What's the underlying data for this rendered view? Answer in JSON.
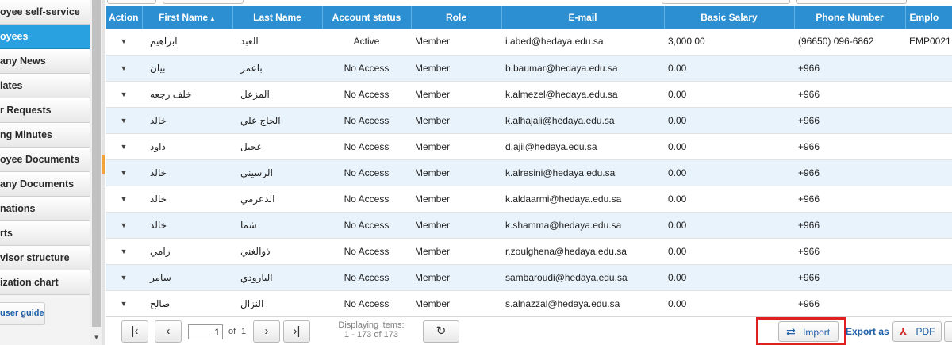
{
  "sidebar": {
    "items": [
      {
        "label": "oyee self-service"
      },
      {
        "label": "oyees"
      },
      {
        "label": "any News"
      },
      {
        "label": "lates"
      },
      {
        "label": "r Requests"
      },
      {
        "label": "ng Minutes"
      },
      {
        "label": "oyee Documents"
      },
      {
        "label": "any Documents"
      },
      {
        "label": "nations"
      },
      {
        "label": "rts"
      },
      {
        "label": "visor structure"
      },
      {
        "label": "ization chart"
      }
    ],
    "guide_label": "user guide"
  },
  "grid": {
    "columns": [
      {
        "label": "Action"
      },
      {
        "label": "First Name"
      },
      {
        "label": "Last Name"
      },
      {
        "label": "Account status"
      },
      {
        "label": "Role"
      },
      {
        "label": "E-mail"
      },
      {
        "label": "Basic Salary"
      },
      {
        "label": "Phone Number"
      },
      {
        "label": "Emplo"
      }
    ],
    "rows": [
      {
        "first": "ابراهيم",
        "last": "العبد",
        "status": "Active",
        "role": "Member",
        "email": "i.abed@hedaya.edu.sa",
        "salary": "3,000.00",
        "phone": "(96650) 096-6862",
        "emp": "EMP0021"
      },
      {
        "first": "بيان",
        "last": "باعمر",
        "status": "No Access",
        "role": "Member",
        "email": "b.baumar@hedaya.edu.sa",
        "salary": "0.00",
        "phone": "+966",
        "emp": ""
      },
      {
        "first": "خلف رجعه",
        "last": "المزعل",
        "status": "No Access",
        "role": "Member",
        "email": "k.almezel@hedaya.edu.sa",
        "salary": "0.00",
        "phone": "+966",
        "emp": ""
      },
      {
        "first": "خالد",
        "last": "الحاج علي",
        "status": "No Access",
        "role": "Member",
        "email": "k.alhajali@hedaya.edu.sa",
        "salary": "0.00",
        "phone": "+966",
        "emp": ""
      },
      {
        "first": "داود",
        "last": "عجيل",
        "status": "No Access",
        "role": "Member",
        "email": "d.ajil@hedaya.edu.sa",
        "salary": "0.00",
        "phone": "+966",
        "emp": ""
      },
      {
        "first": "خالد",
        "last": "الرسيني",
        "status": "No Access",
        "role": "Member",
        "email": "k.alresini@hedaya.edu.sa",
        "salary": "0.00",
        "phone": "+966",
        "emp": ""
      },
      {
        "first": "خالد",
        "last": "الدعرمي",
        "status": "No Access",
        "role": "Member",
        "email": "k.aldaarmi@hedaya.edu.sa",
        "salary": "0.00",
        "phone": "+966",
        "emp": ""
      },
      {
        "first": "خالد",
        "last": "شما",
        "status": "No Access",
        "role": "Member",
        "email": "k.shamma@hedaya.edu.sa",
        "salary": "0.00",
        "phone": "+966",
        "emp": ""
      },
      {
        "first": "رامي",
        "last": "ذوالغني",
        "status": "No Access",
        "role": "Member",
        "email": "r.zoulghena@hedaya.edu.sa",
        "salary": "0.00",
        "phone": "+966",
        "emp": ""
      },
      {
        "first": "سامر",
        "last": "البارودي",
        "status": "No Access",
        "role": "Member",
        "email": "sambaroudi@hedaya.edu.sa",
        "salary": "0.00",
        "phone": "+966",
        "emp": ""
      },
      {
        "first": "صالح",
        "last": "النزال",
        "status": "No Access",
        "role": "Member",
        "email": "s.alnazzal@hedaya.edu.sa",
        "salary": "0.00",
        "phone": "+966",
        "emp": ""
      }
    ]
  },
  "pager": {
    "page_value": "1",
    "of_label": "of",
    "total_pages": "1",
    "display_line1": "Displaying items:",
    "display_line2": "1 - 173 of 173",
    "import_label": "Import",
    "export_label": "Export as",
    "pdf_label": "PDF"
  },
  "icons": {
    "action": "chevron-down-icon",
    "first": "first-page-icon",
    "prev": "prev-page-icon",
    "next": "next-page-icon",
    "last": "last-page-icon",
    "refresh": "refresh-icon",
    "import": "shuffle-icon",
    "pdf": "pdf-icon"
  },
  "colors": {
    "header_blue": "#2b8fd1",
    "active_sidebar": "#29a1e0",
    "highlight_red": "#e02020",
    "alt_row": "#e9f3fc"
  }
}
